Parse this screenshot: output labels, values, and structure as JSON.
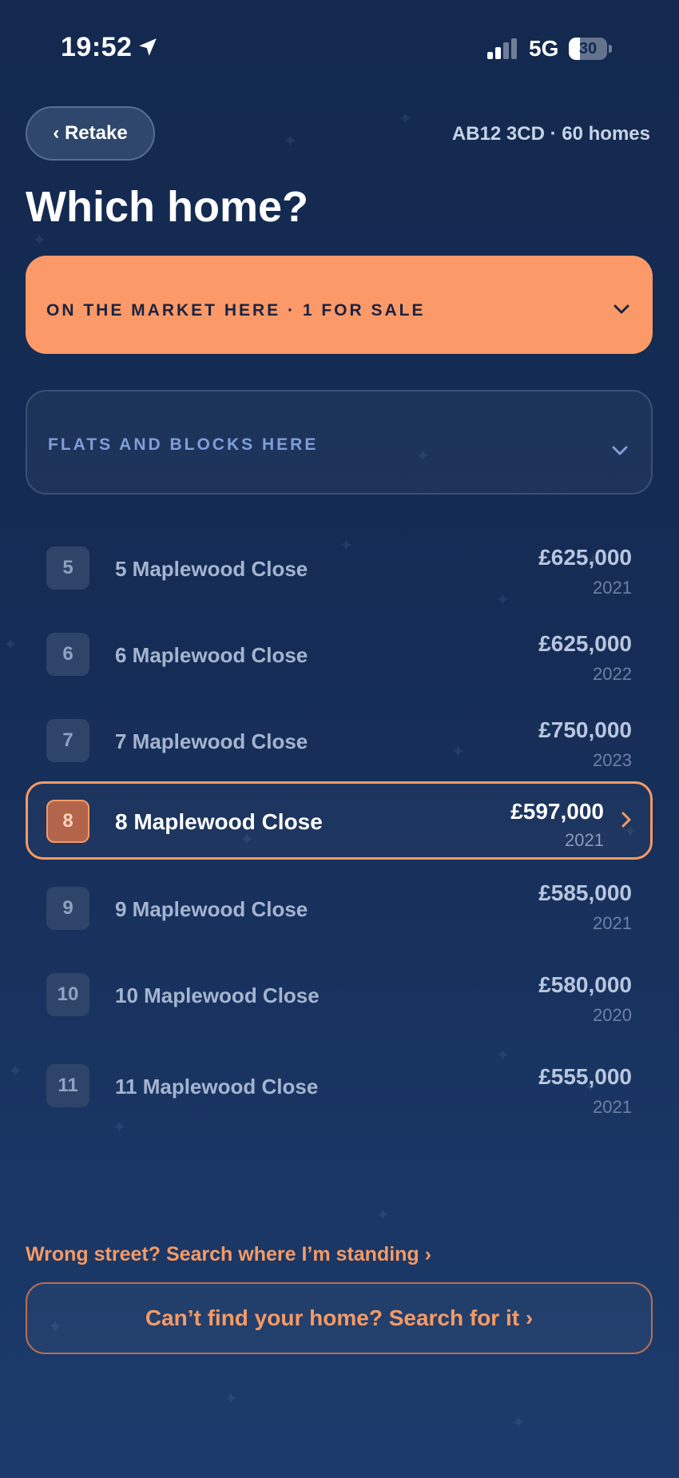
{
  "status_bar": {
    "time": "19:52",
    "network": "5G",
    "battery_level": "30",
    "battery_fraction": 0.3,
    "location_icon": "location-arrow-icon",
    "signal_icon": "signal-bars-icon"
  },
  "header": {
    "retake_label": "‹ Retake",
    "postcode_summary": "AB12 3CD · 60 homes",
    "title": "Which home?"
  },
  "panels": {
    "market": {
      "label": "ON THE MARKET HERE · 1 FOR SALE",
      "icon": "chevron-down-icon"
    },
    "flats": {
      "label": "FLATS AND BLOCKS HERE",
      "icon": "chevron-down-icon"
    }
  },
  "homes": [
    {
      "number": "5",
      "address": "5 Maplewood Close",
      "price": "£625,000",
      "year": "2021",
      "selected": false
    },
    {
      "number": "6",
      "address": "6 Maplewood Close",
      "price": "£625,000",
      "year": "2022",
      "selected": false
    },
    {
      "number": "7",
      "address": "7 Maplewood Close",
      "price": "£750,000",
      "year": "2023",
      "selected": false
    },
    {
      "number": "8",
      "address": "8 Maplewood Close",
      "price": "£597,000",
      "year": "2021",
      "selected": true
    },
    {
      "number": "9",
      "address": "9 Maplewood Close",
      "price": "£585,000",
      "year": "2021",
      "selected": false
    },
    {
      "number": "10",
      "address": "10 Maplewood Close",
      "price": "£580,000",
      "year": "2020",
      "selected": false
    },
    {
      "number": "11",
      "address": "11 Maplewood Close",
      "price": "£555,000",
      "year": "2021",
      "selected": false
    }
  ],
  "footer": {
    "wrong_street": "Wrong street? Search where I’m standing ›",
    "search_button": "Can’t find your home? Search for it ›"
  },
  "colors": {
    "accent": "#fb9a68",
    "background": "#13294f",
    "muted_text": "#a5b4cf"
  }
}
